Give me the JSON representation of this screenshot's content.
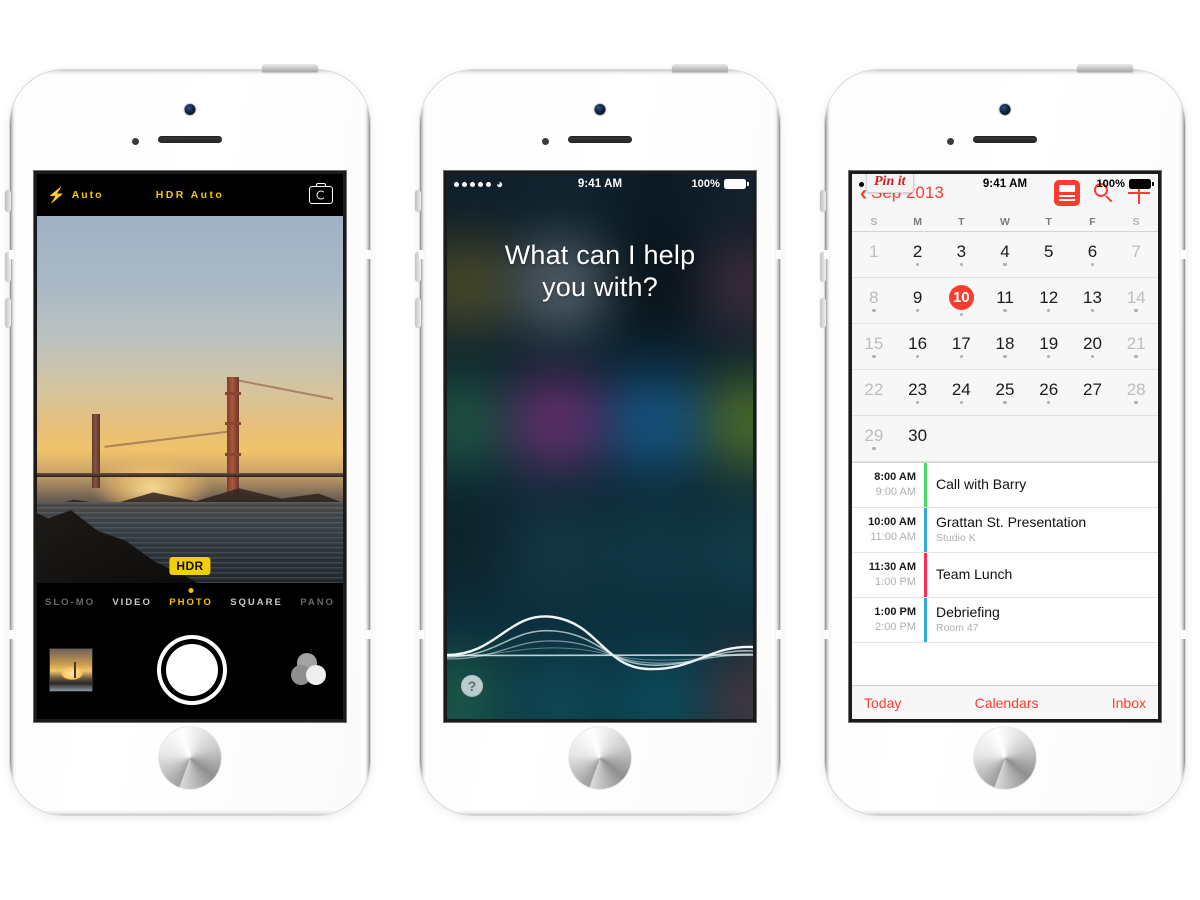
{
  "scene": {
    "title": "Three iPhone 5s devices showing iOS 7 Camera, Siri and Calendar",
    "device_color": "#ffffff",
    "accent_yellow": "#f5c400",
    "accent_red": "#ff3b30"
  },
  "phones": [
    {
      "id": "phone-camera",
      "status_bar": {
        "time": "",
        "battery": "",
        "signal_dots": 0,
        "wifi": ""
      }
    },
    {
      "id": "phone-siri",
      "status_bar": {
        "time": "9:41 AM",
        "battery": "100%",
        "signal_dots": 5,
        "wifi": "wifi-icon"
      }
    },
    {
      "id": "phone-calendar",
      "status_bar": {
        "time": "9:41 AM",
        "battery": "100%",
        "signal_dots": 5,
        "wifi": "wifi-icon"
      }
    }
  ],
  "camera": {
    "flash_label": "Auto",
    "flash_icon": "lightning-bolt-icon",
    "hdr_label": "HDR Auto",
    "switch_camera_icon": "camera-flip-icon",
    "hdr_badge": "HDR",
    "modes": [
      {
        "label": "SLO-MO",
        "state": "dim"
      },
      {
        "label": "VIDEO",
        "state": "normal"
      },
      {
        "label": "PHOTO",
        "state": "active"
      },
      {
        "label": "SQUARE",
        "state": "normal"
      },
      {
        "label": "PANO",
        "state": "dim"
      }
    ],
    "thumbnail_name": "last-photo-thumbnail",
    "shutter_name": "shutter-button",
    "filters_name": "filters-button",
    "scene_description": "Golden Gate Bridge at sunset with rocky shoreline"
  },
  "siri": {
    "prompt_line_1": "What can I help",
    "prompt_line_2": "you with?",
    "help_label": "?",
    "waveform_name": "siri-waveform"
  },
  "calendar": {
    "pin_it_label": "Pin it",
    "back_label": "Sep 2013",
    "back_chevron": "chevron-left-icon",
    "actions": [
      {
        "name": "list-view-icon",
        "selected": true
      },
      {
        "name": "search-icon",
        "selected": false
      },
      {
        "name": "add-event-icon",
        "selected": false
      }
    ],
    "weekdays": [
      "S",
      "M",
      "T",
      "W",
      "T",
      "F",
      "S"
    ],
    "weeks": [
      [
        {
          "day": "1",
          "weekend": true,
          "today": false,
          "dot": false
        },
        {
          "day": "2",
          "weekend": false,
          "today": false,
          "dot": true
        },
        {
          "day": "3",
          "weekend": false,
          "today": false,
          "dot": true
        },
        {
          "day": "4",
          "weekend": false,
          "today": false,
          "dot": true
        },
        {
          "day": "5",
          "weekend": false,
          "today": false,
          "dot": false
        },
        {
          "day": "6",
          "weekend": false,
          "today": false,
          "dot": true
        },
        {
          "day": "7",
          "weekend": true,
          "today": false,
          "dot": false
        }
      ],
      [
        {
          "day": "8",
          "weekend": true,
          "today": false,
          "dot": true
        },
        {
          "day": "9",
          "weekend": false,
          "today": false,
          "dot": true
        },
        {
          "day": "10",
          "weekend": false,
          "today": true,
          "dot": true
        },
        {
          "day": "11",
          "weekend": false,
          "today": false,
          "dot": true
        },
        {
          "day": "12",
          "weekend": false,
          "today": false,
          "dot": true
        },
        {
          "day": "13",
          "weekend": false,
          "today": false,
          "dot": true
        },
        {
          "day": "14",
          "weekend": true,
          "today": false,
          "dot": true
        }
      ],
      [
        {
          "day": "15",
          "weekend": true,
          "today": false,
          "dot": true
        },
        {
          "day": "16",
          "weekend": false,
          "today": false,
          "dot": true
        },
        {
          "day": "17",
          "weekend": false,
          "today": false,
          "dot": true
        },
        {
          "day": "18",
          "weekend": false,
          "today": false,
          "dot": true
        },
        {
          "day": "19",
          "weekend": false,
          "today": false,
          "dot": true
        },
        {
          "day": "20",
          "weekend": false,
          "today": false,
          "dot": true
        },
        {
          "day": "21",
          "weekend": true,
          "today": false,
          "dot": true
        }
      ],
      [
        {
          "day": "22",
          "weekend": true,
          "today": false,
          "dot": false
        },
        {
          "day": "23",
          "weekend": false,
          "today": false,
          "dot": true
        },
        {
          "day": "24",
          "weekend": false,
          "today": false,
          "dot": true
        },
        {
          "day": "25",
          "weekend": false,
          "today": false,
          "dot": true
        },
        {
          "day": "26",
          "weekend": false,
          "today": false,
          "dot": true
        },
        {
          "day": "27",
          "weekend": false,
          "today": false,
          "dot": false
        },
        {
          "day": "28",
          "weekend": true,
          "today": false,
          "dot": true
        }
      ],
      [
        {
          "day": "29",
          "weekend": true,
          "today": false,
          "dot": true
        },
        {
          "day": "30",
          "weekend": false,
          "today": false,
          "dot": false
        },
        {
          "day": "",
          "weekend": false,
          "today": false,
          "dot": false
        },
        {
          "day": "",
          "weekend": false,
          "today": false,
          "dot": false
        },
        {
          "day": "",
          "weekend": false,
          "today": false,
          "dot": false
        },
        {
          "day": "",
          "weekend": false,
          "today": false,
          "dot": false
        },
        {
          "day": "",
          "weekend": false,
          "today": false,
          "dot": false
        }
      ]
    ],
    "events": [
      {
        "start": "8:00 AM",
        "end": "9:00 AM",
        "title": "Call with Barry",
        "location": "",
        "color": "#4cd964"
      },
      {
        "start": "10:00 AM",
        "end": "11:00 AM",
        "title": "Grattan St. Presentation",
        "location": "Studio K",
        "color": "#34aadc"
      },
      {
        "start": "11:30 AM",
        "end": "1:00 PM",
        "title": "Team Lunch",
        "location": "",
        "color": "#ff2d55"
      },
      {
        "start": "1:00 PM",
        "end": "2:00 PM",
        "title": "Debriefing",
        "location": "Room 47",
        "color": "#34aadc"
      }
    ],
    "tabs": [
      {
        "label": "Today"
      },
      {
        "label": "Calendars"
      },
      {
        "label": "Inbox"
      }
    ]
  }
}
